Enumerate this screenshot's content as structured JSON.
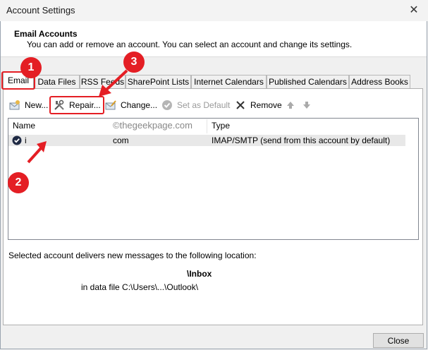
{
  "window": {
    "title": "Account Settings",
    "close_glyph": "✕"
  },
  "header": {
    "title": "Email Accounts",
    "description": "You can add or remove an account. You can select an account and change its settings."
  },
  "tabs": [
    {
      "label": "Email"
    },
    {
      "label": "Data Files"
    },
    {
      "label": "RSS Feeds"
    },
    {
      "label": "SharePoint Lists"
    },
    {
      "label": "Internet Calendars"
    },
    {
      "label": "Published Calendars"
    },
    {
      "label": "Address Books"
    }
  ],
  "toolbar": {
    "new_label": "New...",
    "repair_label": "Repair...",
    "change_label": "Change...",
    "set_default_label": "Set as Default",
    "remove_label": "Remove",
    "icons": [
      "new-account-icon",
      "repair-tools-icon",
      "change-account-icon",
      "set-default-check-icon",
      "remove-x-icon",
      "move-up-arrow-icon",
      "move-down-arrow-icon"
    ]
  },
  "table": {
    "columns": [
      "Name",
      "Type"
    ],
    "rows": [
      {
        "name_prefix": "i",
        "name_suffix": "com",
        "type": "IMAP/SMTP (send from this account by default)"
      }
    ]
  },
  "watermark": "©thegeekpage.com",
  "location": {
    "caption": "Selected account delivers new messages to the following location:",
    "folder": "\\Inbox",
    "data_file": "in data file C:\\Users\\...\\Outlook\\"
  },
  "close_button": "Close",
  "annotations": {
    "badge_color": "#e41e24",
    "badges": [
      "1",
      "2",
      "3"
    ]
  }
}
